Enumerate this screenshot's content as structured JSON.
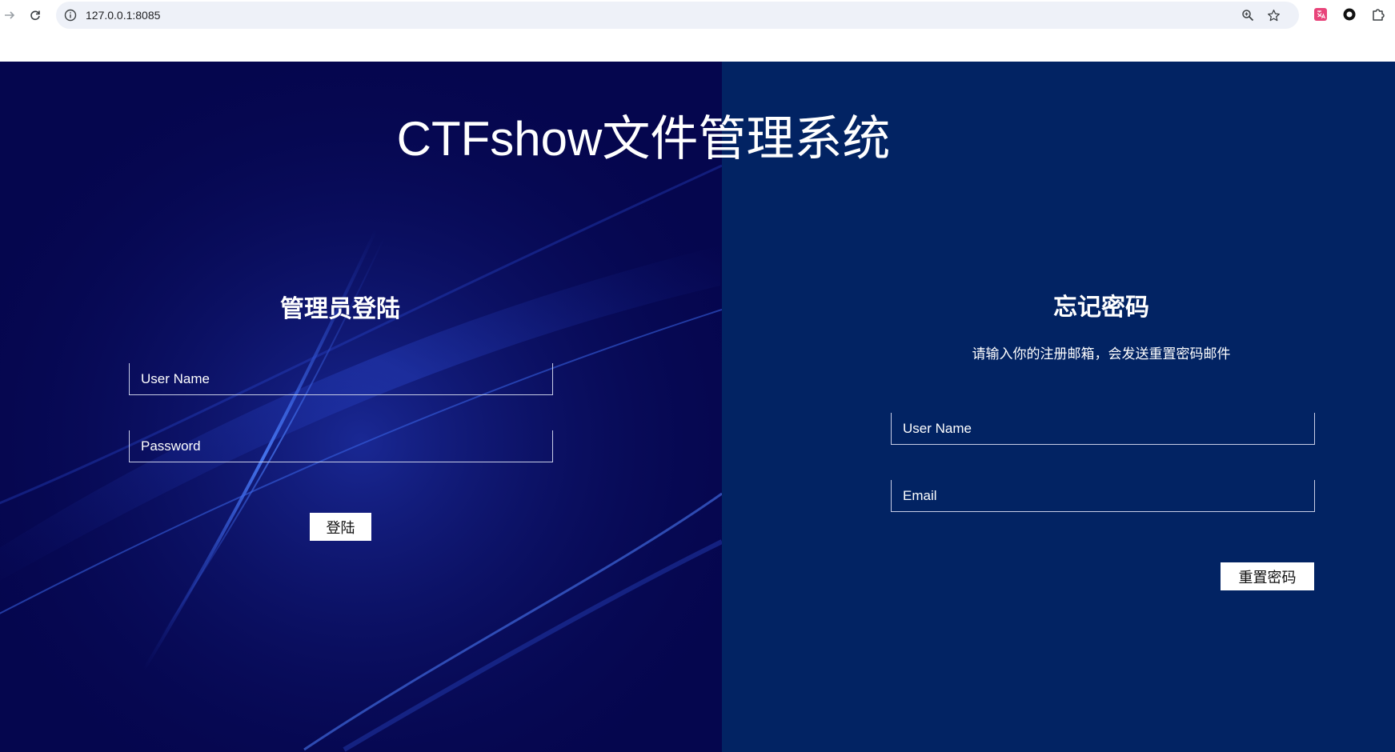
{
  "browser": {
    "url": "127.0.0.1:8085"
  },
  "page": {
    "title": "CTFshow文件管理系统"
  },
  "login": {
    "heading": "管理员登陆",
    "username_placeholder": "User Name",
    "password_placeholder": "Password",
    "submit_label": "登陆"
  },
  "forgot": {
    "heading": "忘记密码",
    "description": "请输入你的注册邮箱，会发送重置密码邮件",
    "username_placeholder": "User Name",
    "email_placeholder": "Email",
    "submit_label": "重置密码"
  },
  "colors": {
    "left_bg": "#05064e",
    "right_bg": "#022363",
    "streak": "#3a6cf0"
  }
}
